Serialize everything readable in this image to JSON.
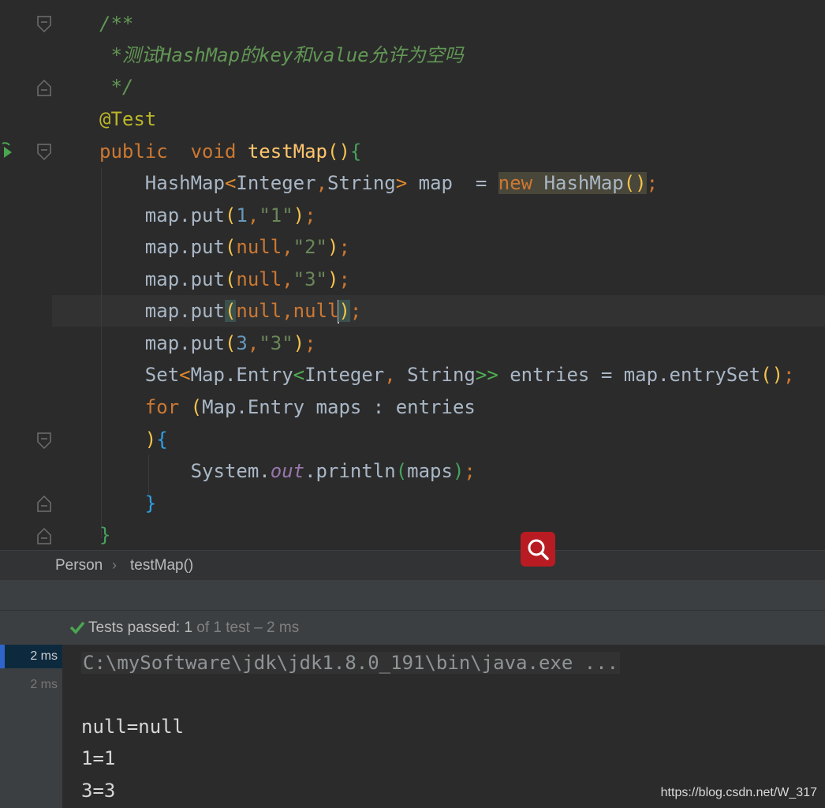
{
  "editor": {
    "lines": [
      [
        {
          "t": "/**",
          "c": "c-comment"
        }
      ],
      [
        {
          "t": " *测试HashMap的key和value允许为空吗",
          "c": "c-comment"
        }
      ],
      [
        {
          "t": " */",
          "c": "c-comment"
        }
      ],
      [
        {
          "t": "@Test",
          "c": "c-anno"
        }
      ],
      [
        {
          "t": "public",
          "c": "c-kw"
        },
        {
          "t": "  "
        },
        {
          "t": "void",
          "c": "c-kw"
        },
        {
          "t": " "
        },
        {
          "t": "testMap",
          "c": "c-fn"
        },
        {
          "t": "()",
          "c": "c-pb1"
        },
        {
          "t": "{",
          "c": "c-pb3"
        }
      ],
      [
        {
          "t": "    HashMap"
        },
        {
          "t": "<",
          "c": "c-ang"
        },
        {
          "t": "Integer"
        },
        {
          "t": ",",
          "c": "c-kw"
        },
        {
          "t": "String"
        },
        {
          "t": ">",
          "c": "c-ang"
        },
        {
          "t": " map  = "
        },
        {
          "t": "new",
          "c": "c-kw hl-new"
        },
        {
          "t": " HashMap",
          "c": "hl-new"
        },
        {
          "t": "()",
          "c": "c-pb1 hl-new"
        },
        {
          "t": ";",
          "c": "c-kw"
        }
      ],
      [
        {
          "t": "    map.put"
        },
        {
          "t": "(",
          "c": "c-pb1"
        },
        {
          "t": "1",
          "c": "c-num"
        },
        {
          "t": ",",
          "c": "c-kw"
        },
        {
          "t": "\"1\"",
          "c": "c-str"
        },
        {
          "t": ")",
          "c": "c-pb1"
        },
        {
          "t": ";",
          "c": "c-kw"
        }
      ],
      [
        {
          "t": "    map.put"
        },
        {
          "t": "(",
          "c": "c-pb1"
        },
        {
          "t": "null",
          "c": "c-kw"
        },
        {
          "t": ",",
          "c": "c-kw"
        },
        {
          "t": "\"2\"",
          "c": "c-str"
        },
        {
          "t": ")",
          "c": "c-pb1"
        },
        {
          "t": ";",
          "c": "c-kw"
        }
      ],
      [
        {
          "t": "    map.put"
        },
        {
          "t": "(",
          "c": "c-pb1"
        },
        {
          "t": "null",
          "c": "c-kw"
        },
        {
          "t": ",",
          "c": "c-kw"
        },
        {
          "t": "\"3\"",
          "c": "c-str"
        },
        {
          "t": ")",
          "c": "c-pb1"
        },
        {
          "t": ";",
          "c": "c-kw"
        }
      ],
      [
        {
          "t": "    map.put"
        },
        {
          "t": "(",
          "c": "c-pb1 hl-paren"
        },
        {
          "t": "null",
          "c": "c-kw"
        },
        {
          "t": ",",
          "c": "c-kw"
        },
        {
          "t": "null",
          "c": "c-kw"
        },
        {
          "caret": true
        },
        {
          "t": ")",
          "c": "c-pb1 hl-paren"
        },
        {
          "t": ";",
          "c": "c-kw"
        }
      ],
      [
        {
          "t": "    map.put"
        },
        {
          "t": "(",
          "c": "c-pb1"
        },
        {
          "t": "3",
          "c": "c-num"
        },
        {
          "t": ",",
          "c": "c-kw"
        },
        {
          "t": "\"3\"",
          "c": "c-str"
        },
        {
          "t": ")",
          "c": "c-pb1"
        },
        {
          "t": ";",
          "c": "c-kw"
        }
      ],
      [
        {
          "t": "    Set"
        },
        {
          "t": "<",
          "c": "c-ang"
        },
        {
          "t": "Map.Entry"
        },
        {
          "t": "<",
          "c": "c-ang2"
        },
        {
          "t": "Integer"
        },
        {
          "t": ",",
          "c": "c-kw"
        },
        {
          "t": " String"
        },
        {
          "t": ">>",
          "c": "c-ang2"
        },
        {
          "t": " entries = map.entrySet"
        },
        {
          "t": "()",
          "c": "c-pb1"
        },
        {
          "t": ";",
          "c": "c-kw"
        }
      ],
      [
        {
          "t": "    "
        },
        {
          "t": "for",
          "c": "c-kw"
        },
        {
          "t": " "
        },
        {
          "t": "(",
          "c": "c-pb1"
        },
        {
          "t": "Map.Entry maps : entries"
        }
      ],
      [
        {
          "t": "    "
        },
        {
          "t": ")",
          "c": "c-pb1"
        },
        {
          "t": "{",
          "c": "c-pb2"
        }
      ],
      [
        {
          "t": "        System."
        },
        {
          "t": "out",
          "c": "c-field"
        },
        {
          "t": ".println"
        },
        {
          "t": "(",
          "c": "c-pb3"
        },
        {
          "t": "maps"
        },
        {
          "t": ")",
          "c": "c-pb3"
        },
        {
          "t": ";",
          "c": "c-kw"
        }
      ],
      [
        {
          "t": "    "
        },
        {
          "t": "}",
          "c": "c-pb2"
        }
      ],
      [
        {
          "t": "}",
          "c": "c-pb3"
        }
      ]
    ]
  },
  "breadcrumb": {
    "class_name": "Person",
    "method_name": "testMap()"
  },
  "tests": {
    "status_label": "Tests passed: ",
    "passed_count": "1",
    "total_label": " of 1 test – 2 ms",
    "check_icon": "check-icon",
    "pass_color": "#4aa64f"
  },
  "tree": {
    "rows": [
      "2 ms",
      "2 ms"
    ]
  },
  "console": {
    "command": "C:\\mySoftware\\jdk\\jdk1.8.0_191\\bin\\java.exe ...",
    "output": [
      "null=null",
      "1=1",
      "3=3"
    ]
  },
  "search_button": {
    "icon": "search-icon",
    "color": "#b81c22"
  },
  "watermark": "https://blog.csdn.net/W_317"
}
